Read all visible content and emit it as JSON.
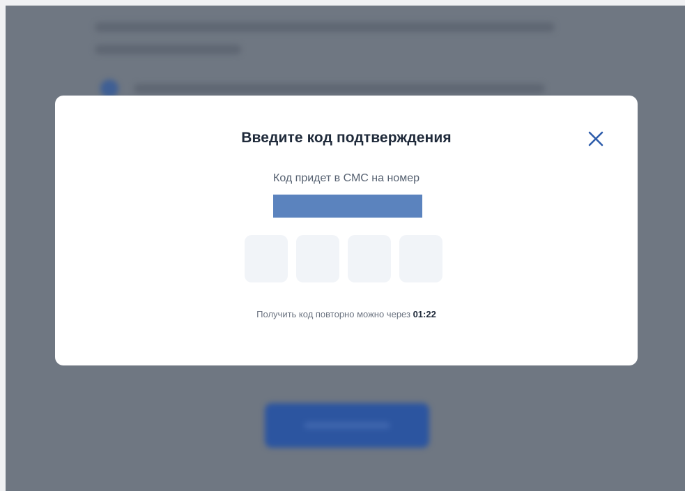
{
  "modal": {
    "title": "Введите код подтверждения",
    "subtitle": "Код придет в СМС на номер",
    "phone_masked": "",
    "code_digits": [
      "",
      "",
      "",
      ""
    ],
    "resend_text": "Получить код повторно можно через",
    "resend_timer": "01:22",
    "close_icon": "close-icon"
  },
  "colors": {
    "overlay": "#6f7782",
    "accent": "#2c55a0",
    "phone_mask": "#5b83be",
    "code_box": "#f1f4f8",
    "close_icon": "#2d5cab"
  }
}
